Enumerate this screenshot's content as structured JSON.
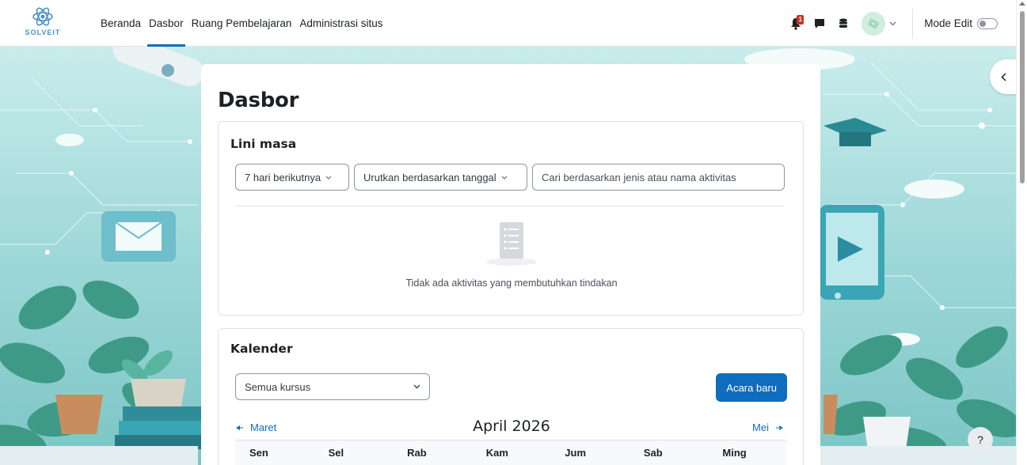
{
  "brand": {
    "logo_text": "SOLVEIT"
  },
  "nav": {
    "links": [
      {
        "label": "Beranda",
        "active": false
      },
      {
        "label": "Dasbor",
        "active": true
      },
      {
        "label": "Ruang Pembelajaran",
        "active": false
      },
      {
        "label": "Administrasi situs",
        "active": false
      }
    ],
    "notification_count": "1",
    "mode_edit_label": "Mode Edit",
    "mode_edit_on": false
  },
  "page": {
    "title": "Dasbor"
  },
  "timeline": {
    "title": "Lini masa",
    "filter_label": "7 hari berikutnya",
    "sort_label": "Urutkan berdasarkan tanggal",
    "search_placeholder": "Cari berdasarkan jenis atau nama aktivitas",
    "empty_message": "Tidak ada aktivitas yang membutuhkan tindakan"
  },
  "calendar": {
    "title": "Kalender",
    "course_filter": "Semua kursus",
    "new_event_label": "Acara baru",
    "prev_month": "Maret",
    "next_month": "Mei",
    "current_month": "April 2026",
    "weekdays": [
      "Sen",
      "Sel",
      "Rab",
      "Kam",
      "Jum",
      "Sab",
      "Ming"
    ]
  },
  "help": {
    "label": "?"
  },
  "colors": {
    "primary": "#0f6cbf",
    "badge": "#ca3120",
    "background_teal": "#9ed8d8"
  }
}
